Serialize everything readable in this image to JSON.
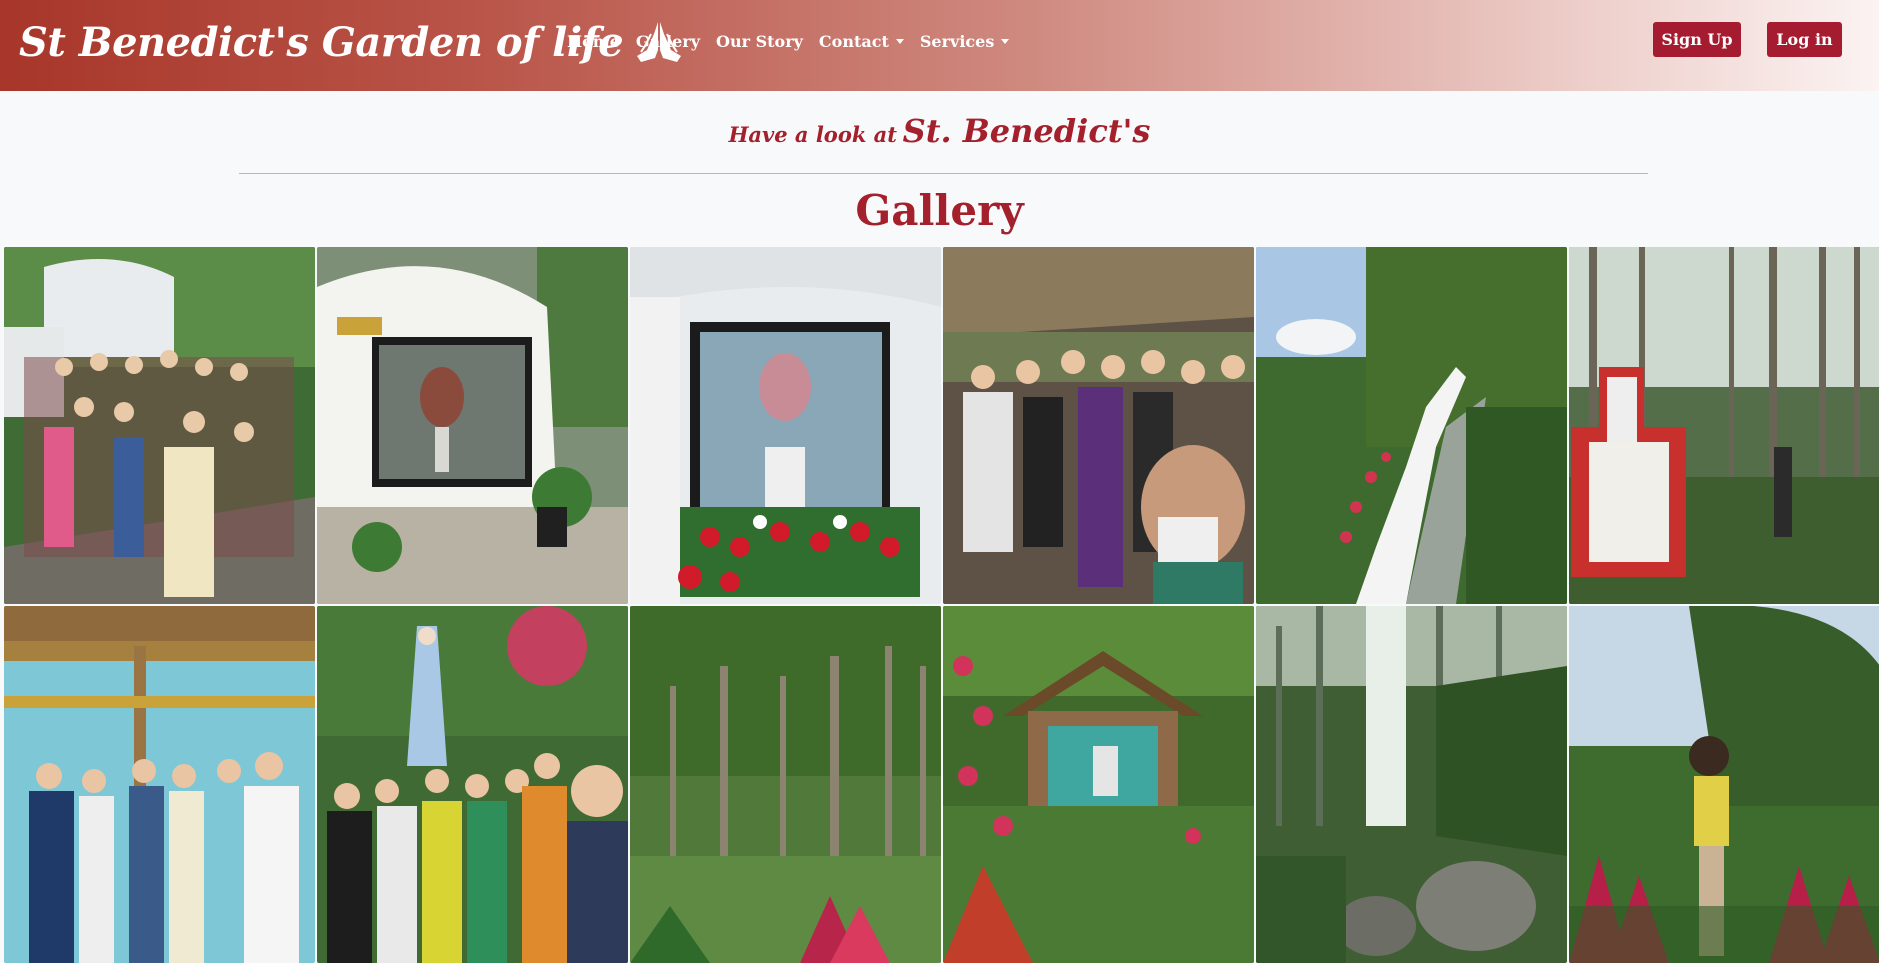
{
  "brand": {
    "title": "St Benedict's Garden of life"
  },
  "nav": {
    "links": [
      {
        "label": "Home",
        "dropdown": false
      },
      {
        "label": "Gallery",
        "dropdown": false
      },
      {
        "label": "Our Story",
        "dropdown": false
      },
      {
        "label": "Contact",
        "dropdown": true
      },
      {
        "label": "Services",
        "dropdown": true
      }
    ],
    "signup_label": "Sign Up",
    "login_label": "Log in"
  },
  "header": {
    "subtitle_prefix": "Have a look at",
    "subtitle_name": "St. Benedict's",
    "title": "Gallery"
  },
  "gallery": {
    "photos": [
      {
        "name": "photo-group-stairs"
      },
      {
        "name": "photo-shrine-window"
      },
      {
        "name": "photo-shrine-flowers"
      },
      {
        "name": "photo-group-tent"
      },
      {
        "name": "photo-garden-path"
      },
      {
        "name": "photo-forest-cross"
      },
      {
        "name": "photo-group-chapel"
      },
      {
        "name": "photo-group-mary-statue"
      },
      {
        "name": "photo-forest-trees"
      },
      {
        "name": "photo-garden-hut"
      },
      {
        "name": "photo-waterfall-rocks"
      },
      {
        "name": "photo-woman-garden"
      }
    ]
  },
  "colors": {
    "accent": "#a3202c",
    "button": "#a51c30",
    "nav_gradient_start": "#a8362a",
    "background": "#f8f9fa"
  }
}
